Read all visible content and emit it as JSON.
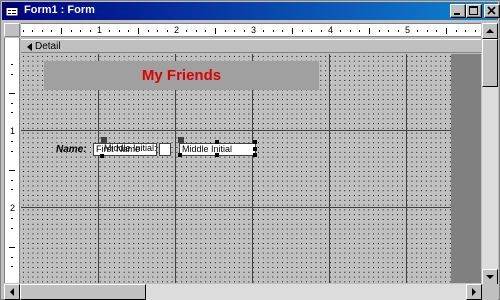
{
  "window": {
    "title": "Form1 : Form"
  },
  "ruler": {
    "h_numbers": [
      "1",
      "2",
      "3",
      "4",
      "5"
    ],
    "v_numbers": [
      "1",
      "2"
    ]
  },
  "section": {
    "label": "Detail"
  },
  "form": {
    "heading": "My Friends",
    "name_label": "Name:",
    "first_name_text": "First Name",
    "overlap_label_text": "Middle Initial:",
    "middle_initial_text": "Middle Initial"
  },
  "colors": {
    "titlebar_start": "#000080",
    "heading_text": "#e00000",
    "heading_bg": "#a0a0a0"
  },
  "icons": {
    "system": "form-icon",
    "minimize": "minimize-icon",
    "maximize": "maximize-icon",
    "close": "close-icon"
  }
}
